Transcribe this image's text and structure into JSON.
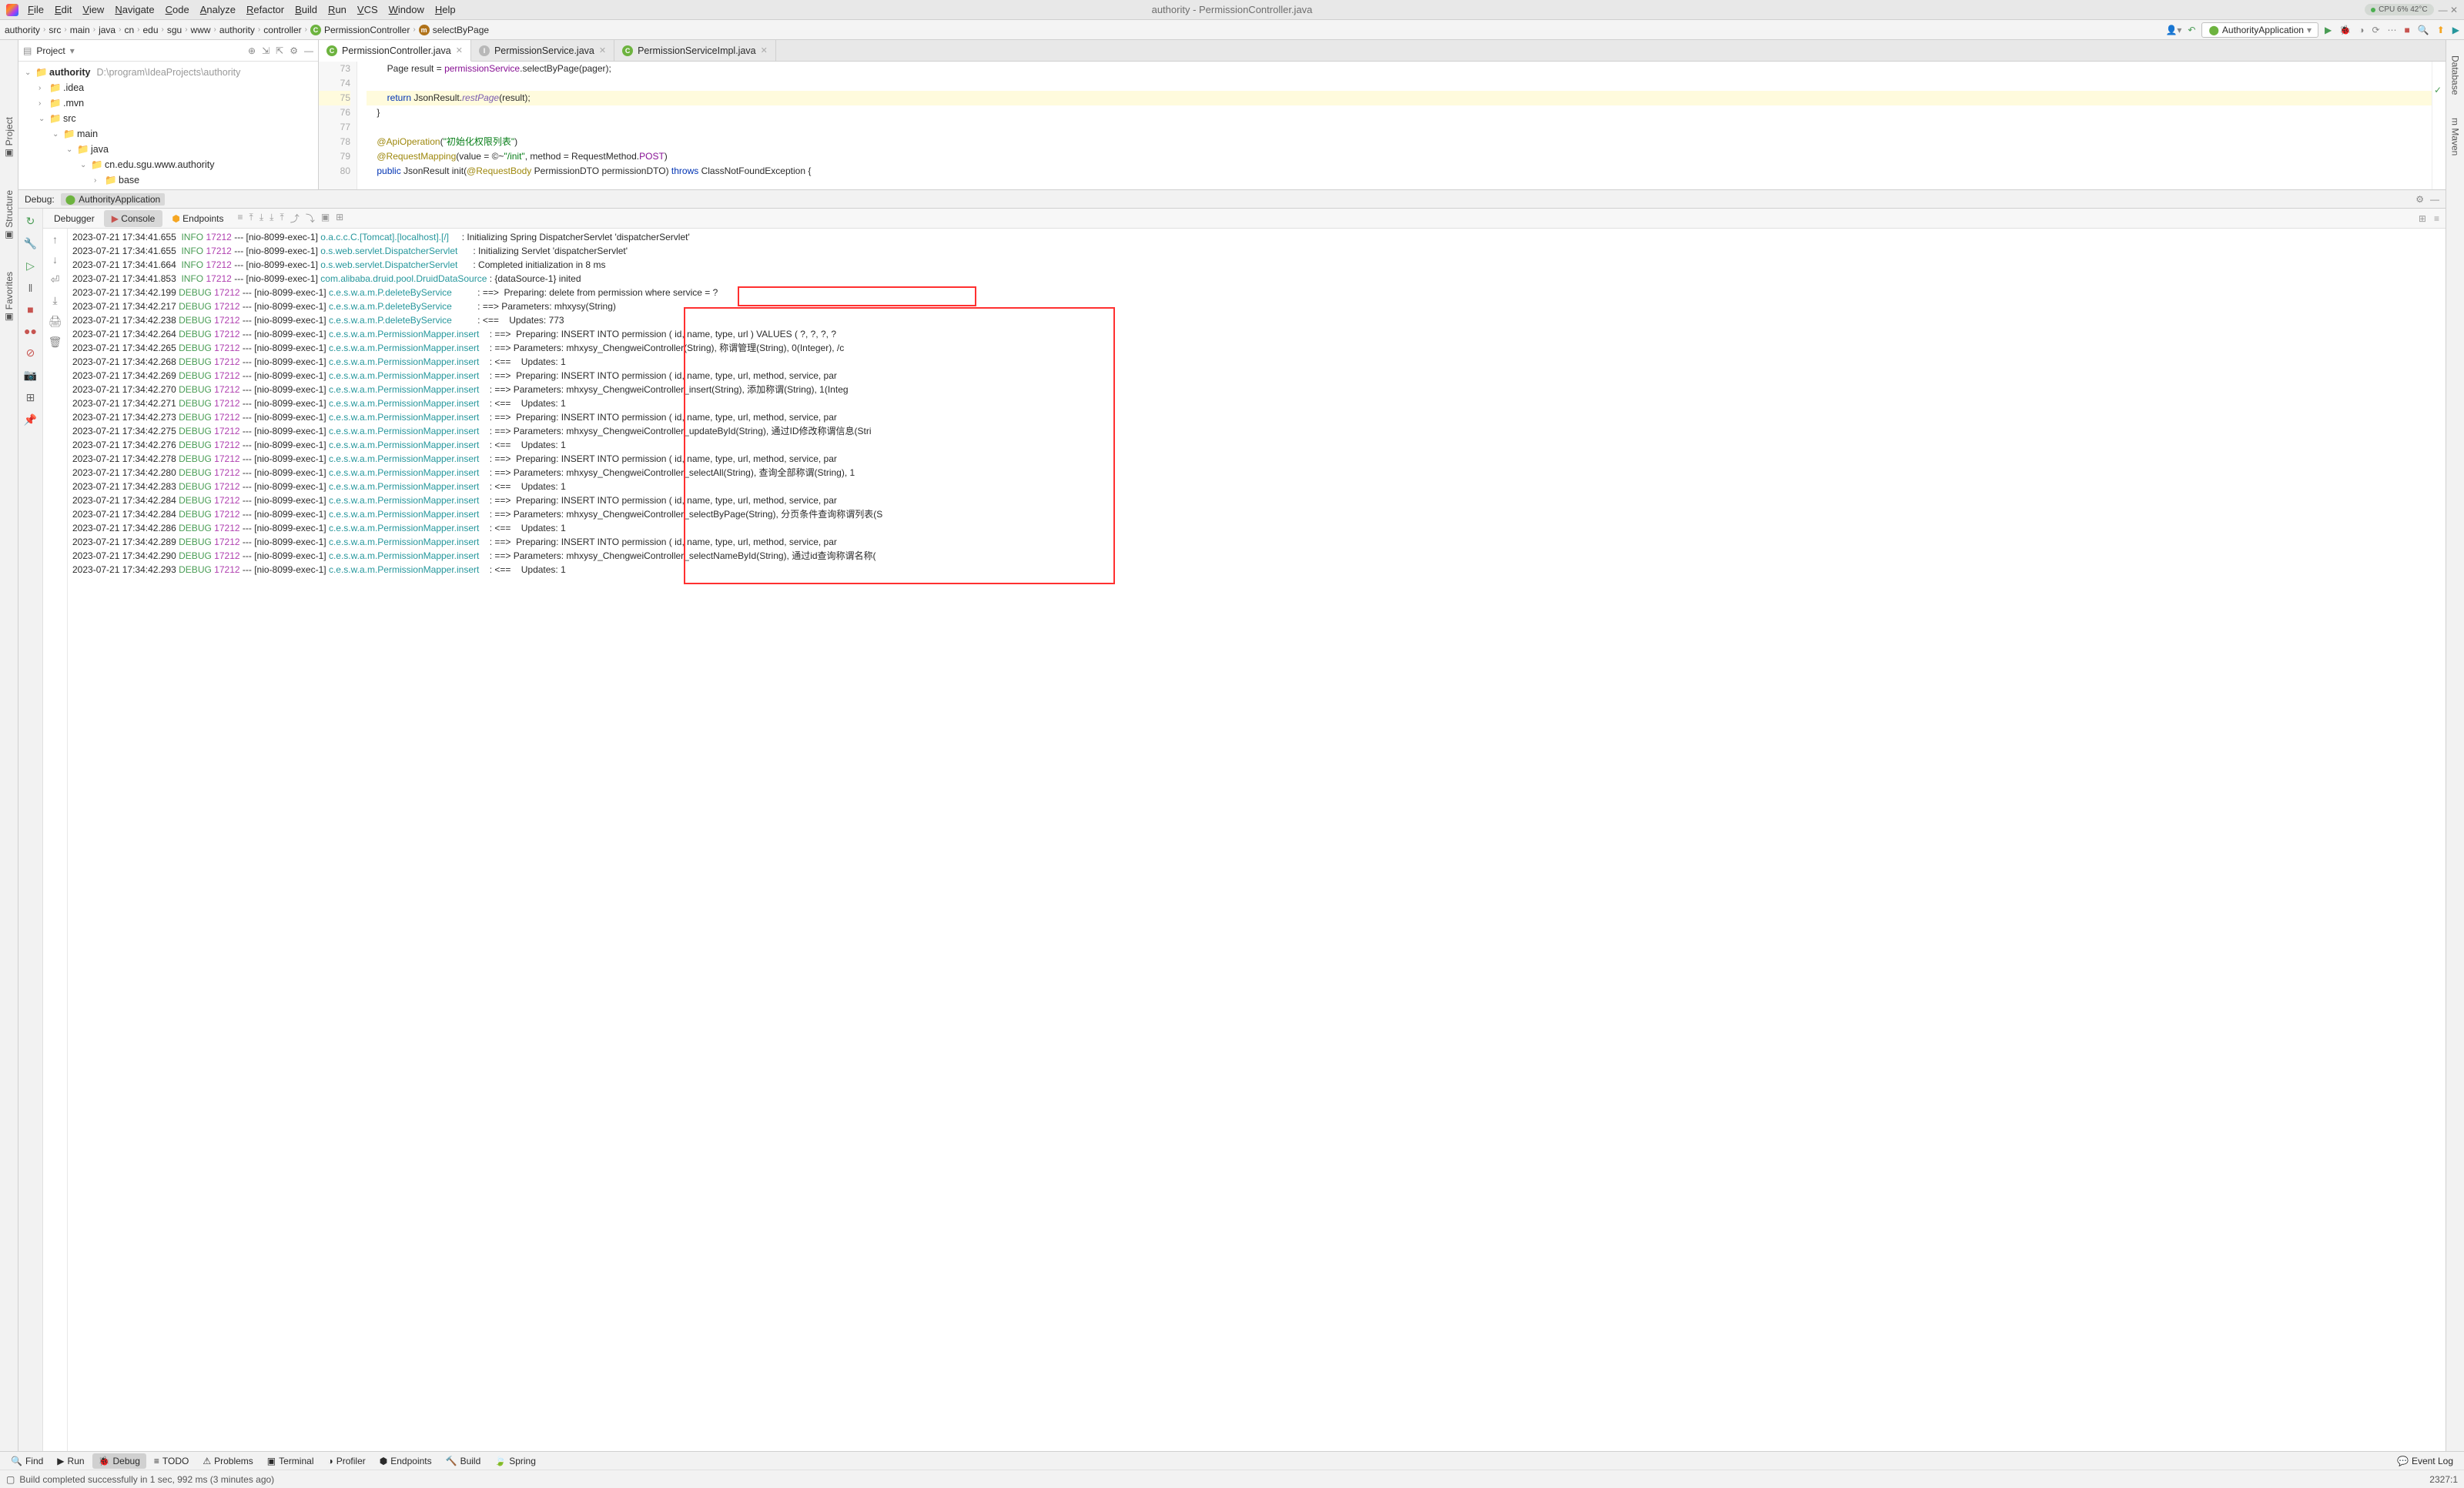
{
  "title_bar": {
    "menus": [
      "File",
      "Edit",
      "View",
      "Navigate",
      "Code",
      "Analyze",
      "Refactor",
      "Build",
      "Run",
      "VCS",
      "Window",
      "Help"
    ],
    "title": "authority - PermissionController.java",
    "cpu": "CPU 6% 42°C"
  },
  "breadcrumb": {
    "items": [
      "authority",
      "src",
      "main",
      "java",
      "cn",
      "edu",
      "sgu",
      "www",
      "authority",
      "controller"
    ],
    "class": "PermissionController",
    "method": "selectByPage",
    "run_config": "AuthorityApplication"
  },
  "project": {
    "header": "Project",
    "root_name": "authority",
    "root_path": "D:\\program\\IdeaProjects\\authority",
    "nodes": [
      {
        "depth": 1,
        "arrow": "›",
        "label": ".idea"
      },
      {
        "depth": 1,
        "arrow": "›",
        "label": ".mvn"
      },
      {
        "depth": 1,
        "arrow": "⌄",
        "label": "src"
      },
      {
        "depth": 2,
        "arrow": "⌄",
        "label": "main",
        "highlight": true
      },
      {
        "depth": 3,
        "arrow": "⌄",
        "label": "java",
        "highlight": true
      },
      {
        "depth": 4,
        "arrow": "⌄",
        "label": "cn.edu.sgu.www.authority"
      },
      {
        "depth": 5,
        "arrow": "›",
        "label": "base"
      }
    ]
  },
  "editor": {
    "tabs": [
      {
        "name": "PermissionController.java",
        "icon": "c",
        "active": true
      },
      {
        "name": "PermissionService.java",
        "icon": "j",
        "active": false
      },
      {
        "name": "PermissionServiceImpl.java",
        "icon": "c",
        "active": false
      }
    ],
    "lines": [
      {
        "num": 73,
        "html": "        Page<Permission> result = <span class='fld'>permissionService</span>.selectByPage(pager);"
      },
      {
        "num": 74,
        "html": ""
      },
      {
        "num": 75,
        "html": "        <span class='kw'>return</span> JsonResult.<span class='mthd'>restPage</span>(result);",
        "hl": true
      },
      {
        "num": 76,
        "html": "    }"
      },
      {
        "num": 77,
        "html": ""
      },
      {
        "num": 78,
        "html": "    <span class='ann'>@ApiOperation</span>(<span class='str'>\"初始化权限列表\"</span>)"
      },
      {
        "num": 79,
        "html": "    <span class='ann'>@RequestMapping</span>(value = ©~<span class='str'>\"/init\"</span>, method = RequestMethod.<span class='fld'>POST</span>)"
      },
      {
        "num": 80,
        "html": "    <span class='kw'>public</span> JsonResult<Void> init(<span class='ann'>@RequestBody</span> PermissionDTO permissionDTO) <span class='kw'>throws</span> ClassNotFoundException {"
      }
    ]
  },
  "debug": {
    "label": "Debug:",
    "app": "AuthorityApplication",
    "tabs": [
      "Debugger",
      "Console",
      "Endpoints"
    ],
    "console_lines": [
      {
        "ts": "2023-07-21 17:34:41.655",
        "lvl": "INFO",
        "pid": "17212",
        "thread": "[nio-8099-exec-1]",
        "logger": "o.a.c.c.C.[Tomcat].[localhost].[/]",
        "msg": ": Initializing Spring DispatcherServlet 'dispatcherServlet'"
      },
      {
        "ts": "2023-07-21 17:34:41.655",
        "lvl": "INFO",
        "pid": "17212",
        "thread": "[nio-8099-exec-1]",
        "logger": "o.s.web.servlet.DispatcherServlet",
        "msg": ": Initializing Servlet 'dispatcherServlet'"
      },
      {
        "ts": "2023-07-21 17:34:41.664",
        "lvl": "INFO",
        "pid": "17212",
        "thread": "[nio-8099-exec-1]",
        "logger": "o.s.web.servlet.DispatcherServlet",
        "msg": ": Completed initialization in 8 ms"
      },
      {
        "ts": "2023-07-21 17:34:41.853",
        "lvl": "INFO",
        "pid": "17212",
        "thread": "[nio-8099-exec-1]",
        "logger": "com.alibaba.druid.pool.DruidDataSource",
        "msg": ": {dataSource-1} inited"
      },
      {
        "ts": "2023-07-21 17:34:42.199",
        "lvl": "DEBUG",
        "pid": "17212",
        "thread": "[nio-8099-exec-1]",
        "logger": "c.e.s.w.a.m.P.deleteByService",
        "msg": ": ==>  Preparing: delete from permission where service = ?"
      },
      {
        "ts": "2023-07-21 17:34:42.217",
        "lvl": "DEBUG",
        "pid": "17212",
        "thread": "[nio-8099-exec-1]",
        "logger": "c.e.s.w.a.m.P.deleteByService",
        "msg": ": ==> Parameters: mhxysy(String)"
      },
      {
        "ts": "2023-07-21 17:34:42.238",
        "lvl": "DEBUG",
        "pid": "17212",
        "thread": "[nio-8099-exec-1]",
        "logger": "c.e.s.w.a.m.P.deleteByService",
        "msg": ": <==    Updates: 773"
      },
      {
        "ts": "2023-07-21 17:34:42.264",
        "lvl": "DEBUG",
        "pid": "17212",
        "thread": "[nio-8099-exec-1]",
        "logger": "c.e.s.w.a.m.PermissionMapper.insert",
        "msg": ": ==>  Preparing: INSERT INTO permission ( id, name, type, url ) VALUES ( ?, ?, ?, ?"
      },
      {
        "ts": "2023-07-21 17:34:42.265",
        "lvl": "DEBUG",
        "pid": "17212",
        "thread": "[nio-8099-exec-1]",
        "logger": "c.e.s.w.a.m.PermissionMapper.insert",
        "msg": ": ==> Parameters: mhxysy_ChengweiController(String), 称谓管理(String), 0(Integer), /c"
      },
      {
        "ts": "2023-07-21 17:34:42.268",
        "lvl": "DEBUG",
        "pid": "17212",
        "thread": "[nio-8099-exec-1]",
        "logger": "c.e.s.w.a.m.PermissionMapper.insert",
        "msg": ": <==    Updates: 1"
      },
      {
        "ts": "2023-07-21 17:34:42.269",
        "lvl": "DEBUG",
        "pid": "17212",
        "thread": "[nio-8099-exec-1]",
        "logger": "c.e.s.w.a.m.PermissionMapper.insert",
        "msg": ": ==>  Preparing: INSERT INTO permission ( id, name, type, url, method, service, par"
      },
      {
        "ts": "2023-07-21 17:34:42.270",
        "lvl": "DEBUG",
        "pid": "17212",
        "thread": "[nio-8099-exec-1]",
        "logger": "c.e.s.w.a.m.PermissionMapper.insert",
        "msg": ": ==> Parameters: mhxysy_ChengweiController_insert(String), 添加称谓(String), 1(Integ"
      },
      {
        "ts": "2023-07-21 17:34:42.271",
        "lvl": "DEBUG",
        "pid": "17212",
        "thread": "[nio-8099-exec-1]",
        "logger": "c.e.s.w.a.m.PermissionMapper.insert",
        "msg": ": <==    Updates: 1"
      },
      {
        "ts": "2023-07-21 17:34:42.273",
        "lvl": "DEBUG",
        "pid": "17212",
        "thread": "[nio-8099-exec-1]",
        "logger": "c.e.s.w.a.m.PermissionMapper.insert",
        "msg": ": ==>  Preparing: INSERT INTO permission ( id, name, type, url, method, service, par"
      },
      {
        "ts": "2023-07-21 17:34:42.275",
        "lvl": "DEBUG",
        "pid": "17212",
        "thread": "[nio-8099-exec-1]",
        "logger": "c.e.s.w.a.m.PermissionMapper.insert",
        "msg": ": ==> Parameters: mhxysy_ChengweiController_updateById(String), 通过ID修改称谓信息(Stri"
      },
      {
        "ts": "2023-07-21 17:34:42.276",
        "lvl": "DEBUG",
        "pid": "17212",
        "thread": "[nio-8099-exec-1]",
        "logger": "c.e.s.w.a.m.PermissionMapper.insert",
        "msg": ": <==    Updates: 1"
      },
      {
        "ts": "2023-07-21 17:34:42.278",
        "lvl": "DEBUG",
        "pid": "17212",
        "thread": "[nio-8099-exec-1]",
        "logger": "c.e.s.w.a.m.PermissionMapper.insert",
        "msg": ": ==>  Preparing: INSERT INTO permission ( id, name, type, url, method, service, par"
      },
      {
        "ts": "2023-07-21 17:34:42.280",
        "lvl": "DEBUG",
        "pid": "17212",
        "thread": "[nio-8099-exec-1]",
        "logger": "c.e.s.w.a.m.PermissionMapper.insert",
        "msg": ": ==> Parameters: mhxysy_ChengweiController_selectAll(String), 查询全部称谓(String), 1"
      },
      {
        "ts": "2023-07-21 17:34:42.283",
        "lvl": "DEBUG",
        "pid": "17212",
        "thread": "[nio-8099-exec-1]",
        "logger": "c.e.s.w.a.m.PermissionMapper.insert",
        "msg": ": <==    Updates: 1"
      },
      {
        "ts": "2023-07-21 17:34:42.284",
        "lvl": "DEBUG",
        "pid": "17212",
        "thread": "[nio-8099-exec-1]",
        "logger": "c.e.s.w.a.m.PermissionMapper.insert",
        "msg": ": ==>  Preparing: INSERT INTO permission ( id, name, type, url, method, service, par"
      },
      {
        "ts": "2023-07-21 17:34:42.284",
        "lvl": "DEBUG",
        "pid": "17212",
        "thread": "[nio-8099-exec-1]",
        "logger": "c.e.s.w.a.m.PermissionMapper.insert",
        "msg": ": ==> Parameters: mhxysy_ChengweiController_selectByPage(String), 分页条件查询称谓列表(S"
      },
      {
        "ts": "2023-07-21 17:34:42.286",
        "lvl": "DEBUG",
        "pid": "17212",
        "thread": "[nio-8099-exec-1]",
        "logger": "c.e.s.w.a.m.PermissionMapper.insert",
        "msg": ": <==    Updates: 1"
      },
      {
        "ts": "2023-07-21 17:34:42.289",
        "lvl": "DEBUG",
        "pid": "17212",
        "thread": "[nio-8099-exec-1]",
        "logger": "c.e.s.w.a.m.PermissionMapper.insert",
        "msg": ": ==>  Preparing: INSERT INTO permission ( id, name, type, url, method, service, par"
      },
      {
        "ts": "2023-07-21 17:34:42.290",
        "lvl": "DEBUG",
        "pid": "17212",
        "thread": "[nio-8099-exec-1]",
        "logger": "c.e.s.w.a.m.PermissionMapper.insert",
        "msg": ": ==> Parameters: mhxysy_ChengweiController_selectNameById(String), 通过id查询称谓名称("
      },
      {
        "ts": "2023-07-21 17:34:42.293",
        "lvl": "DEBUG",
        "pid": "17212",
        "thread": "[nio-8099-exec-1]",
        "logger": "c.e.s.w.a.m.PermissionMapper.insert",
        "msg": ": <==    Updates: 1"
      }
    ]
  },
  "bottom_tabs": [
    "Find",
    "Run",
    "Debug",
    "TODO",
    "Problems",
    "Terminal",
    "Profiler",
    "Endpoints",
    "Build",
    "Spring"
  ],
  "bottom_right": "Event Log",
  "status_bar": {
    "left": "Build completed successfully in 1 sec, 992 ms (3 minutes ago)",
    "right": "2327:1"
  },
  "right_sidebar_items": [
    "Database",
    "m Maven"
  ],
  "left_sidebar_items": [
    "Project",
    "Structure",
    "Favorites"
  ]
}
